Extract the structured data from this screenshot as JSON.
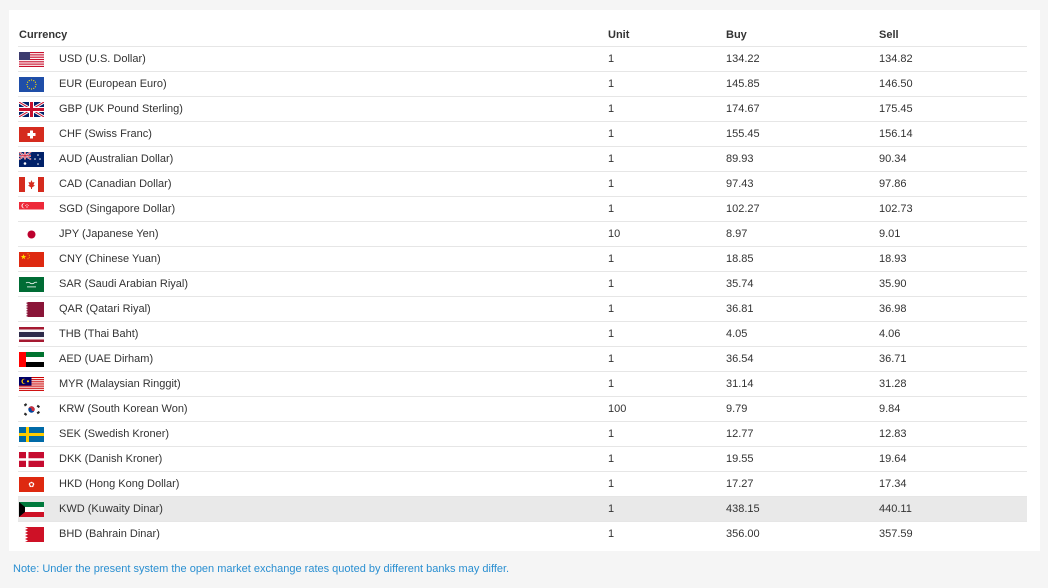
{
  "table": {
    "headers": {
      "currency": "Currency",
      "unit": "Unit",
      "buy": "Buy",
      "sell": "Sell"
    },
    "rows": [
      {
        "flag": "usa-flag-icon",
        "currency": "USD (U.S. Dollar)",
        "unit": "1",
        "buy": "134.22",
        "sell": "134.82"
      },
      {
        "flag": "eu-flag-icon",
        "currency": "EUR (European Euro)",
        "unit": "1",
        "buy": "145.85",
        "sell": "146.50"
      },
      {
        "flag": "uk-flag-icon",
        "currency": "GBP (UK Pound Sterling)",
        "unit": "1",
        "buy": "174.67",
        "sell": "175.45"
      },
      {
        "flag": "switzerland-flag-icon",
        "currency": "CHF (Swiss Franc)",
        "unit": "1",
        "buy": "155.45",
        "sell": "156.14"
      },
      {
        "flag": "australia-flag-icon",
        "currency": "AUD (Australian Dollar)",
        "unit": "1",
        "buy": "89.93",
        "sell": "90.34"
      },
      {
        "flag": "canada-flag-icon",
        "currency": "CAD (Canadian Dollar)",
        "unit": "1",
        "buy": "97.43",
        "sell": "97.86"
      },
      {
        "flag": "singapore-flag-icon",
        "currency": "SGD (Singapore Dollar)",
        "unit": "1",
        "buy": "102.27",
        "sell": "102.73"
      },
      {
        "flag": "japan-flag-icon",
        "currency": "JPY (Japanese Yen)",
        "unit": "10",
        "buy": "8.97",
        "sell": "9.01"
      },
      {
        "flag": "china-flag-icon",
        "currency": "CNY (Chinese Yuan)",
        "unit": "1",
        "buy": "18.85",
        "sell": "18.93"
      },
      {
        "flag": "saudi-arabia-flag-icon",
        "currency": "SAR (Saudi Arabian Riyal)",
        "unit": "1",
        "buy": "35.74",
        "sell": "35.90"
      },
      {
        "flag": "qatar-flag-icon",
        "currency": "QAR (Qatari Riyal)",
        "unit": "1",
        "buy": "36.81",
        "sell": "36.98"
      },
      {
        "flag": "thailand-flag-icon",
        "currency": "THB (Thai Baht)",
        "unit": "1",
        "buy": "4.05",
        "sell": "4.06"
      },
      {
        "flag": "uae-flag-icon",
        "currency": "AED (UAE Dirham)",
        "unit": "1",
        "buy": "36.54",
        "sell": "36.71"
      },
      {
        "flag": "malaysia-flag-icon",
        "currency": "MYR (Malaysian Ringgit)",
        "unit": "1",
        "buy": "31.14",
        "sell": "31.28"
      },
      {
        "flag": "south-korea-flag-icon",
        "currency": "KRW (South Korean Won)",
        "unit": "100",
        "buy": "9.79",
        "sell": "9.84"
      },
      {
        "flag": "sweden-flag-icon",
        "currency": "SEK (Swedish Kroner)",
        "unit": "1",
        "buy": "12.77",
        "sell": "12.83"
      },
      {
        "flag": "denmark-flag-icon",
        "currency": "DKK (Danish Kroner)",
        "unit": "1",
        "buy": "19.55",
        "sell": "19.64"
      },
      {
        "flag": "hong-kong-flag-icon",
        "currency": "HKD (Hong Kong Dollar)",
        "unit": "1",
        "buy": "17.27",
        "sell": "17.34"
      },
      {
        "flag": "kuwait-flag-icon",
        "currency": "KWD (Kuwaity Dinar)",
        "unit": "1",
        "buy": "438.15",
        "sell": "440.11",
        "highlighted": true
      },
      {
        "flag": "bahrain-flag-icon",
        "currency": "BHD (Bahrain Dinar)",
        "unit": "1",
        "buy": "356.00",
        "sell": "357.59"
      }
    ]
  },
  "note": "Note: Under the present system the open market exchange rates quoted by different banks may differ.",
  "colors": {
    "note_text": "#2a8fd1",
    "highlight_row": "#e9e9e9",
    "row_border": "#e6e6e6"
  }
}
